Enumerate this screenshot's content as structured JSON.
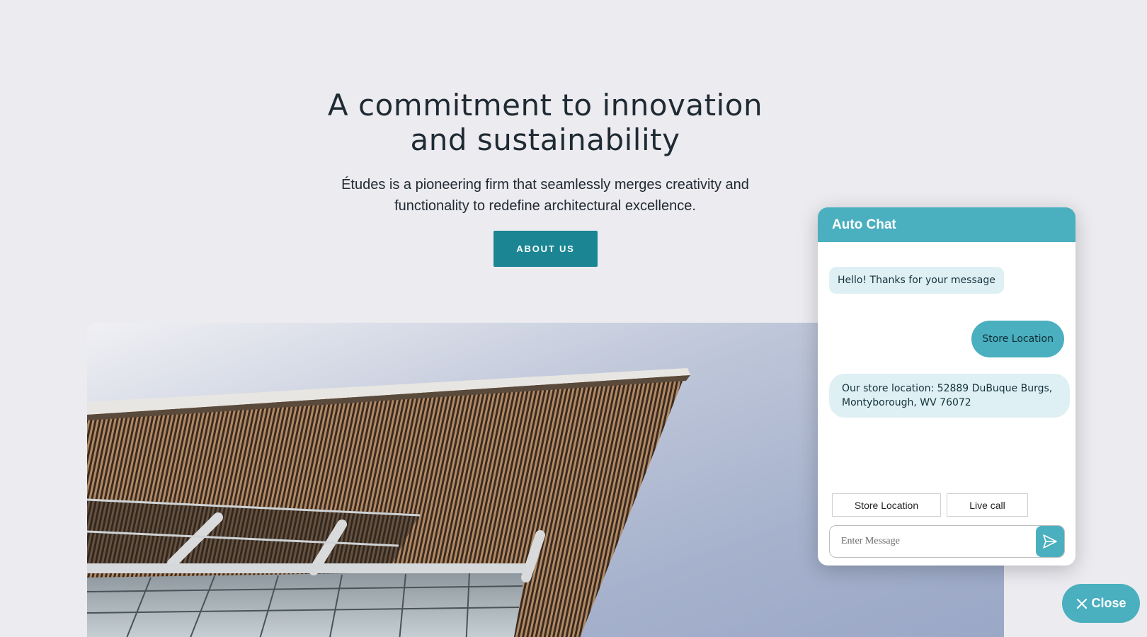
{
  "hero": {
    "title_line1": "A commitment to innovation",
    "title_line2": "and sustainability",
    "subtitle_line1": "Études is a pioneering firm that seamlessly merges creativity and",
    "subtitle_line2": "functionality to redefine architectural excellence.",
    "button_label": "ABOUT US"
  },
  "chat": {
    "title": "Auto Chat",
    "messages": [
      {
        "from": "bot",
        "text": "Hello! Thanks for your message"
      },
      {
        "from": "user",
        "text": "Store Location"
      },
      {
        "from": "bot",
        "text": "Our store location: 52889 DuBuque Burgs, Montyborough, WV 76072"
      }
    ],
    "quick_replies": [
      "Store Location",
      "Live call"
    ],
    "input_placeholder": "Enter Message",
    "send_icon": "send-icon"
  },
  "close_button": {
    "label": "Close",
    "icon": "close-icon"
  },
  "colors": {
    "page_bg": "#ebebf0",
    "primary_button": "#1b8593",
    "chat_accent": "#4aafbf",
    "bot_bubble": "#dff0f4"
  }
}
